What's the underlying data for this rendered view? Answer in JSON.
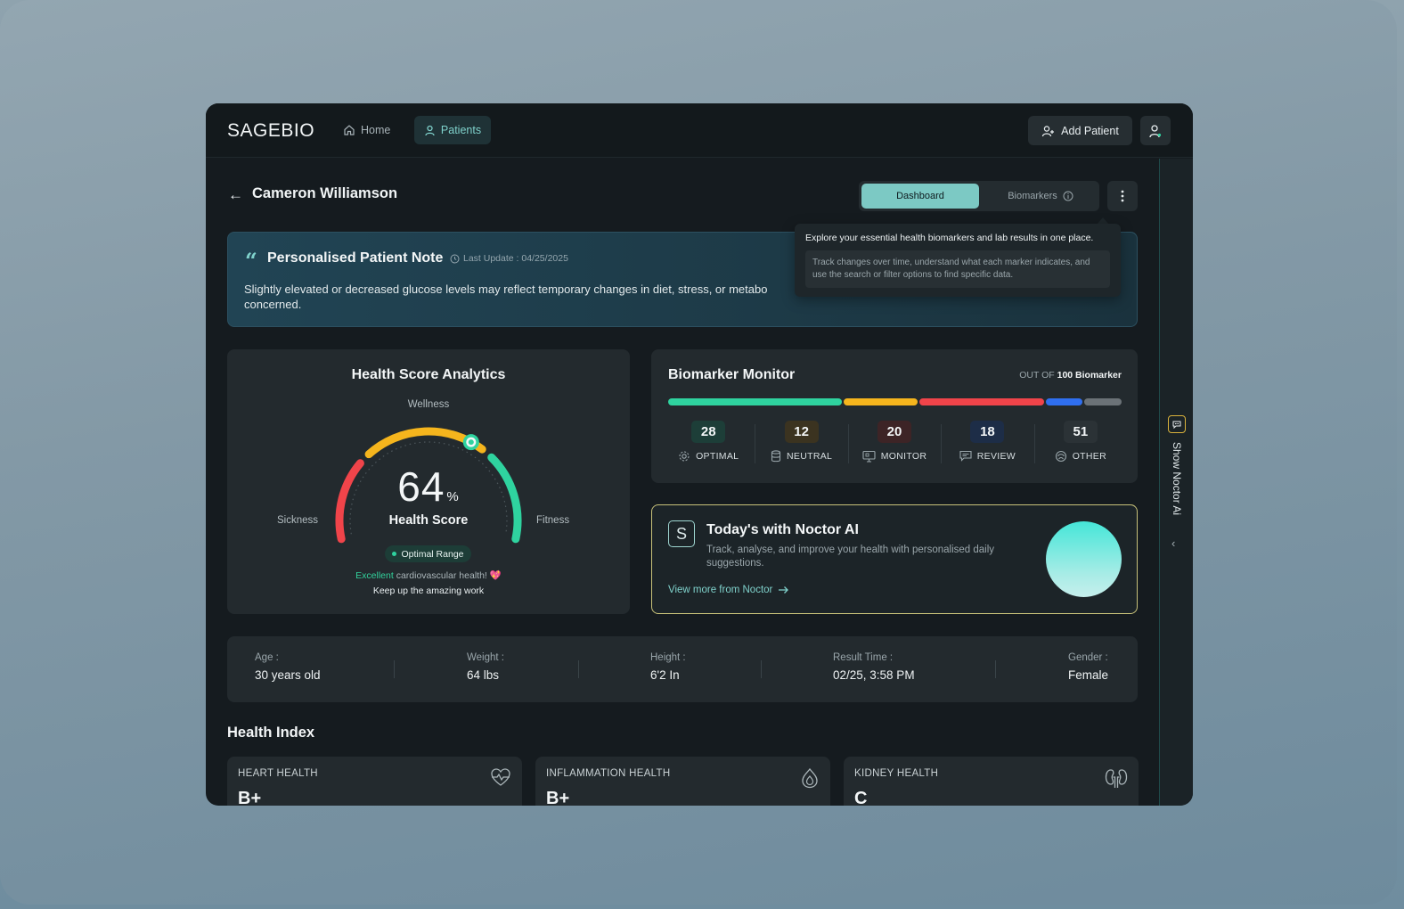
{
  "brand": {
    "logo": "SAGEBIO"
  },
  "nav": {
    "home_label": "Home",
    "patients_label": "Patients",
    "add_patient_label": "Add Patient"
  },
  "header": {
    "patient_name": "Cameron Williamson",
    "tabs": [
      {
        "label": "Dashboard",
        "active": true
      },
      {
        "label": "Biomarkers",
        "active": false
      }
    ]
  },
  "note": {
    "title": "Personalised Patient Note",
    "last_update": "Last Update : 04/25/2025",
    "body": "Slightly elevated or decreased glucose levels may reflect temporary changes in diet, stress, or metabo",
    "body_cont": "concerned."
  },
  "tooltip": {
    "title": "Explore your essential health biomarkers and lab results in one place.",
    "body": "Track changes over time, understand what each marker indicates, and use the search or filter options to find specific data."
  },
  "health_score": {
    "title": "Health Score Analytics",
    "value": "64",
    "value_fraction": 0.64,
    "unit": "%",
    "label": "Health Score",
    "wellness_label": "Wellness",
    "sickness_label": "Sickness",
    "fitness_label": "Fitness",
    "range_badge": "Optimal Range",
    "excellent": "Excellent",
    "message_rest": "cardiovascular health!",
    "message_emoji": "💖",
    "tagline": "Keep up the amazing work",
    "colors": {
      "red": "#f0444a",
      "yellow": "#f5b51d",
      "green": "#2fd39f"
    }
  },
  "biomarker": {
    "title": "Biomarker Monitor",
    "out_of_prefix": "OUT OF",
    "out_of_value": "100 Biomarker",
    "stats": [
      {
        "value": "28",
        "label": "OPTIMAL",
        "icon": "gear-icon",
        "color": "#2fd39f",
        "badge_bg": "#1d3e38"
      },
      {
        "value": "12",
        "label": "NEUTRAL",
        "icon": "database-icon",
        "color": "#f5b51d",
        "badge_bg": "#3b3320"
      },
      {
        "value": "20",
        "label": "MONITOR",
        "icon": "monitor-icon",
        "color": "#f0444a",
        "badge_bg": "#3d2426"
      },
      {
        "value": "18",
        "label": "REVIEW",
        "icon": "comment-icon",
        "color": "#2f6ff0",
        "badge_bg": "#1d2d47"
      },
      {
        "value": "51",
        "label": "OTHER",
        "icon": "other-icon",
        "color": "#6b7277",
        "badge_bg": "#2b3236"
      }
    ],
    "bar_weights": [
      28,
      12,
      20,
      6,
      6
    ]
  },
  "noctor": {
    "badge": "S",
    "title": "Today's with Noctor AI",
    "body": "Track, analyse, and improve your health with personalised daily suggestions.",
    "link": "View more from Noctor"
  },
  "side_panel": {
    "label": "Show Noctor Ai"
  },
  "info": [
    {
      "key": "Age :",
      "value": "30 years old"
    },
    {
      "key": "Weight :",
      "value": "64 lbs"
    },
    {
      "key": "Height :",
      "value": "6'2 In"
    },
    {
      "key": "Result Time :",
      "value": "02/25, 3:58 PM"
    },
    {
      "key": "Gender :",
      "value": "Female"
    }
  ],
  "health_index": {
    "title": "Health Index",
    "cards": [
      {
        "name": "HEART HEALTH",
        "grade": "B+",
        "icon": "heart-pulse-icon"
      },
      {
        "name": "INFLAMMATION HEALTH",
        "grade": "B+",
        "icon": "drop-icon"
      },
      {
        "name": "KIDNEY HEALTH",
        "grade": "C",
        "icon": "kidney-icon"
      }
    ]
  }
}
